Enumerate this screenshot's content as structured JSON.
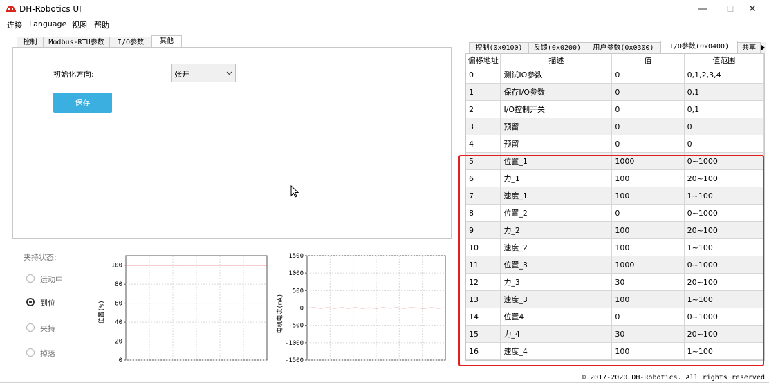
{
  "window": {
    "title": "DH-Robotics UI",
    "minimize": "—",
    "maximize": "☐",
    "close": "✕"
  },
  "menu": [
    "连接",
    "Language",
    "视图",
    "帮助"
  ],
  "left_tabs": [
    "控制",
    "Modbus-RTU参数",
    "I/O参数",
    "其他"
  ],
  "other_panel": {
    "init_direction_label": "初始化方向:",
    "init_direction_value": "张开",
    "save_label": "保存"
  },
  "status": {
    "title": "夹持状态:",
    "options": [
      {
        "label": "运动中",
        "checked": false
      },
      {
        "label": "到位",
        "checked": true
      },
      {
        "label": "夹持",
        "checked": false
      },
      {
        "label": "掉落",
        "checked": false
      }
    ]
  },
  "chart_data": [
    {
      "type": "line",
      "ylabel": "位置(%)",
      "ylim": [
        0,
        110
      ],
      "yticks": [
        "100",
        "80",
        "60",
        "40",
        "20",
        "0"
      ],
      "grid": true,
      "series": [
        {
          "color": "#e04040",
          "values": [
            100,
            100,
            100,
            100,
            100,
            100,
            100,
            100,
            100,
            100
          ]
        }
      ]
    },
    {
      "type": "line",
      "ylabel": "电机电流(mA)",
      "ylim": [
        -1500,
        1500
      ],
      "yticks": [
        "1500",
        "1000",
        "500",
        "0",
        "-500",
        "-1000",
        "-1500"
      ],
      "grid": true,
      "series": [
        {
          "color": "#e04040",
          "values": [
            0,
            5,
            -4,
            3,
            -6,
            4,
            -3,
            6,
            -5,
            2,
            -4,
            5,
            -2,
            3,
            -6,
            4,
            0,
            -3,
            5,
            -4,
            2
          ]
        }
      ]
    }
  ],
  "right_tabs": [
    "控制(0x0100)",
    "反馈(0x0200)",
    "用户参数(0x0300)",
    "I/O参数(0x0400)",
    "共享"
  ],
  "table": {
    "headers": [
      "偏移地址",
      "描述",
      "值",
      "值范围"
    ],
    "rows": [
      [
        "0",
        "测试IO参数",
        "0",
        "0,1,2,3,4"
      ],
      [
        "1",
        "保存I/O参数",
        "0",
        "0,1"
      ],
      [
        "2",
        "I/O控制开关",
        "0",
        "0,1"
      ],
      [
        "3",
        "预留",
        "0",
        "0"
      ],
      [
        "4",
        "预留",
        "0",
        "0"
      ],
      [
        "5",
        "位置_1",
        "1000",
        "0~1000"
      ],
      [
        "6",
        "力_1",
        "100",
        "20~100"
      ],
      [
        "7",
        "速度_1",
        "100",
        "1~100"
      ],
      [
        "8",
        "位置_2",
        "0",
        "0~1000"
      ],
      [
        "9",
        "力_2",
        "100",
        "20~100"
      ],
      [
        "10",
        "速度_2",
        "100",
        "1~100"
      ],
      [
        "11",
        "位置_3",
        "1000",
        "0~1000"
      ],
      [
        "12",
        "力_3",
        "30",
        "20~100"
      ],
      [
        "13",
        "速度_3",
        "100",
        "1~100"
      ],
      [
        "14",
        "位置4",
        "0",
        "0~1000"
      ],
      [
        "15",
        "力_4",
        "30",
        "20~100"
      ],
      [
        "16",
        "速度_4",
        "100",
        "1~100"
      ]
    ]
  },
  "highlight_color": "#e02020",
  "footer": "© 2017-2020 DH-Robotics. All rights reserved"
}
